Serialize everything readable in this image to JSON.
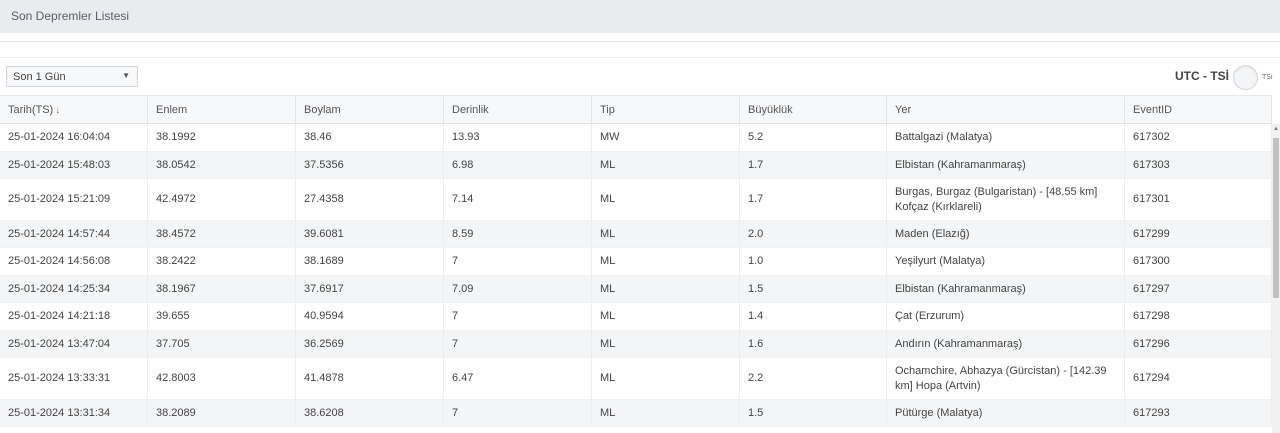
{
  "page": {
    "title": "Son Depremler Listesi"
  },
  "filters": {
    "period_select": {
      "selected": "Son 1 Gün"
    },
    "timezone_toggle": {
      "label": "UTC - TSİ",
      "state_label": "TSi"
    }
  },
  "table": {
    "columns": [
      {
        "key": "date",
        "label": "Tarih(TS)",
        "sorted": "desc"
      },
      {
        "key": "lat",
        "label": "Enlem"
      },
      {
        "key": "lon",
        "label": "Boylam"
      },
      {
        "key": "depth",
        "label": "Derinlik"
      },
      {
        "key": "type",
        "label": "Tip"
      },
      {
        "key": "mag",
        "label": "Büyüklük"
      },
      {
        "key": "place",
        "label": "Yer"
      },
      {
        "key": "event",
        "label": "EventID"
      }
    ],
    "rows": [
      {
        "date": "25-01-2024 16:04:04",
        "lat": "38.1992",
        "lon": "38.46",
        "depth": "13.93",
        "type": "MW",
        "mag": "5.2",
        "place": "Battalgazi (Malatya)",
        "event": "617302"
      },
      {
        "date": "25-01-2024 15:48:03",
        "lat": "38.0542",
        "lon": "37.5356",
        "depth": "6.98",
        "type": "ML",
        "mag": "1.7",
        "place": "Elbistan (Kahramanmaraş)",
        "event": "617303"
      },
      {
        "date": "25-01-2024 15:21:09",
        "lat": "42.4972",
        "lon": "27.4358",
        "depth": "7.14",
        "type": "ML",
        "mag": "1.7",
        "place": "Burgas, Burgaz (Bulgaristan) - [48.55 km] Kofçaz (Kırklareli)",
        "event": "617301"
      },
      {
        "date": "25-01-2024 14:57:44",
        "lat": "38.4572",
        "lon": "39.6081",
        "depth": "8.59",
        "type": "ML",
        "mag": "2.0",
        "place": "Maden (Elazığ)",
        "event": "617299"
      },
      {
        "date": "25-01-2024 14:56:08",
        "lat": "38.2422",
        "lon": "38.1689",
        "depth": "7",
        "type": "ML",
        "mag": "1.0",
        "place": "Yeşilyurt (Malatya)",
        "event": "617300"
      },
      {
        "date": "25-01-2024 14:25:34",
        "lat": "38.1967",
        "lon": "37.6917",
        "depth": "7.09",
        "type": "ML",
        "mag": "1.5",
        "place": "Elbistan (Kahramanmaraş)",
        "event": "617297"
      },
      {
        "date": "25-01-2024 14:21:18",
        "lat": "39.655",
        "lon": "40.9594",
        "depth": "7",
        "type": "ML",
        "mag": "1.4",
        "place": "Çat (Erzurum)",
        "event": "617298"
      },
      {
        "date": "25-01-2024 13:47:04",
        "lat": "37.705",
        "lon": "36.2569",
        "depth": "7",
        "type": "ML",
        "mag": "1.6",
        "place": "Andırın (Kahramanmaraş)",
        "event": "617296"
      },
      {
        "date": "25-01-2024 13:33:31",
        "lat": "42.8003",
        "lon": "41.4878",
        "depth": "6.47",
        "type": "ML",
        "mag": "2.2",
        "place": "Ochamchire, Abhazya (Gürcistan) - [142.39 km] Hopa (Artvin)",
        "event": "617294"
      },
      {
        "date": "25-01-2024 13:31:34",
        "lat": "38.2089",
        "lon": "38.6208",
        "depth": "7",
        "type": "ML",
        "mag": "1.5",
        "place": "Pütürge (Malatya)",
        "event": "617293"
      }
    ]
  },
  "icons": {
    "sort": "arrow-down-icon",
    "select": "caret-down-icon",
    "scroll": "scroll-up-icon"
  },
  "colors": {
    "sort_arrow": "#d9534f",
    "header_bg": "#e9ebee",
    "row_alt": "#f4f5f6"
  }
}
